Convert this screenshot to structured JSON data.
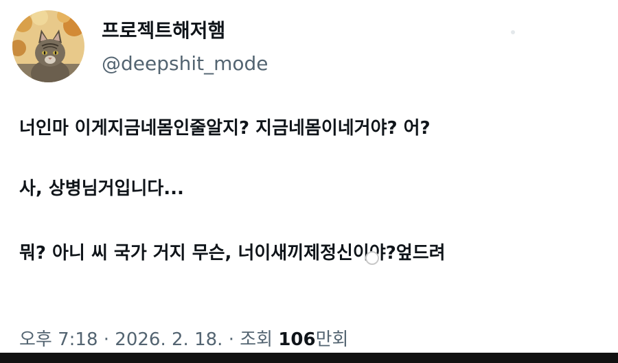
{
  "profile": {
    "display_name": "프로젝트해저햄",
    "handle": "@deepshit_mode",
    "avatar_icon": "cat-avatar-icon"
  },
  "tweet": {
    "line1": "너인마 이게지금네몸인줄알지? 지금네몸이네거야? 어?",
    "line2": "사, 상병님거입니다...",
    "line3": "뭐? 아니 씨 국가 거지 무슨, 너이새끼제정신이야?엎드려"
  },
  "meta": {
    "time": "오후 7:18",
    "separator": "·",
    "date": "2026. 2. 18.",
    "views_label": "조회",
    "views_number": "106",
    "views_unit": "만회"
  },
  "colors": {
    "text_primary": "#0f1419",
    "text_secondary": "#536471",
    "background": "#ffffff"
  }
}
